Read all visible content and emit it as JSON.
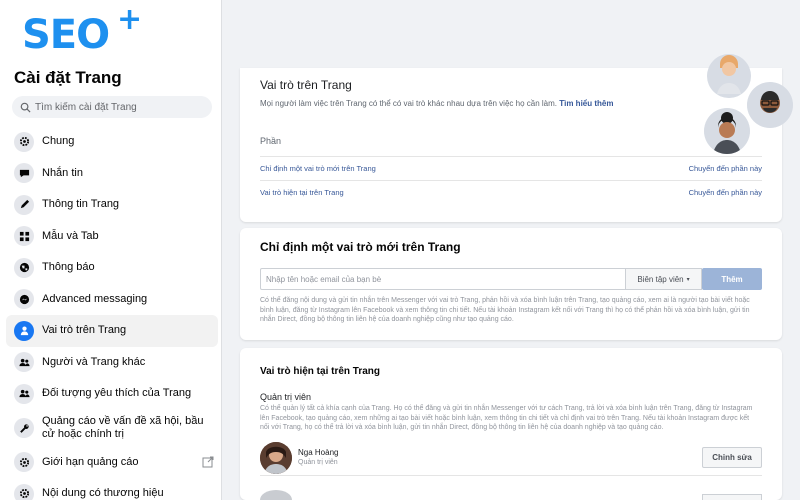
{
  "logo": {
    "text": "SEO",
    "plus": "+"
  },
  "sidebar": {
    "title": "Cài đặt Trang",
    "search_placeholder": "Tìm kiếm cài đặt Trang",
    "items": [
      {
        "label": "Chung",
        "icon": "gear-icon"
      },
      {
        "label": "Nhắn tin",
        "icon": "chat-icon"
      },
      {
        "label": "Thông tin Trang",
        "icon": "pencil-icon"
      },
      {
        "label": "Mẫu và Tab",
        "icon": "grid-icon"
      },
      {
        "label": "Thông báo",
        "icon": "globe-icon"
      },
      {
        "label": "Advanced messaging",
        "icon": "messenger-icon"
      },
      {
        "label": "Vai trò trên Trang",
        "icon": "user-icon"
      },
      {
        "label": "Người và Trang khác",
        "icon": "people-icon"
      },
      {
        "label": "Đối tượng yêu thích của Trang",
        "icon": "people-icon"
      },
      {
        "label": "Quảng cáo về vấn đề xã hội, bầu cử hoặc chính trị",
        "icon": "wrench-icon"
      },
      {
        "label": "Giới hạn quảng cáo",
        "icon": "gear-icon"
      },
      {
        "label": "Nội dung có thương hiệu",
        "icon": "gear-icon"
      }
    ],
    "active_index": 6
  },
  "roles_panel": {
    "title": "Vai trò trên Trang",
    "description": "Mọi người làm việc trên Trang có thể có vai trò khác nhau dựa trên việc họ cần làm.",
    "learn_more": "Tìm hiểu thêm",
    "section_label": "Phần",
    "rows": [
      {
        "link": "Chỉ định một vai trò mới trên Trang",
        "action": "Chuyển đến phần này"
      },
      {
        "link": "Vai trò hiện tại trên Trang",
        "action": "Chuyển đến phần này"
      }
    ]
  },
  "assign_panel": {
    "title": "Chỉ định một vai trò mới trên Trang",
    "input_placeholder": "Nhập tên hoặc email của bạn bè",
    "role_select": "Biên tập viên",
    "add_button": "Thêm",
    "help_text": "Có thể đăng nội dung và gửi tin nhắn trên Messenger với vai trò Trang, phản hồi và xóa bình luận trên Trang, tạo quảng cáo, xem ai là người tạo bài viết hoặc bình luận, đăng từ Instagram lên Facebook và xem thông tin chi tiết. Nếu tài khoản Instagram kết nối với Trang thì họ có thể phản hồi và xóa bình luận, gửi tin nhắn Direct, đồng bộ thông tin liên hệ của doanh nghiệp cũng như tạo quảng cáo."
  },
  "current_panel": {
    "title": "Vai trò hiện tại trên Trang",
    "admin_label": "Quản trị viên",
    "admin_desc": "Có thể quản lý tất cả khía cạnh của Trang. Họ có thể đăng và gửi tin nhắn Messenger với tư cách Trang, trả lời và xóa bình luận trên Trang, đăng từ Instagram lên Facebook, tạo quảng cáo, xem những ai tạo bài viết hoặc bình luận, xem thông tin chi tiết và chỉ định vai trò trên Trang. Nếu tài khoản Instagram được kết nối với Trang, họ có thể trả lời và xóa bình luận, gửi tin nhắn Direct, đồng bộ thông tin liên hệ của doanh nghiệp và tạo quảng cáo.",
    "people": [
      {
        "name": "Nga Hoàng",
        "role": "Quản trị viên",
        "edit": "Chỉnh sửa"
      }
    ]
  },
  "colors": {
    "brand": "#1e90ef",
    "fb_blue": "#1877f2",
    "link": "#385898",
    "add_button": "#9cb4d8"
  }
}
